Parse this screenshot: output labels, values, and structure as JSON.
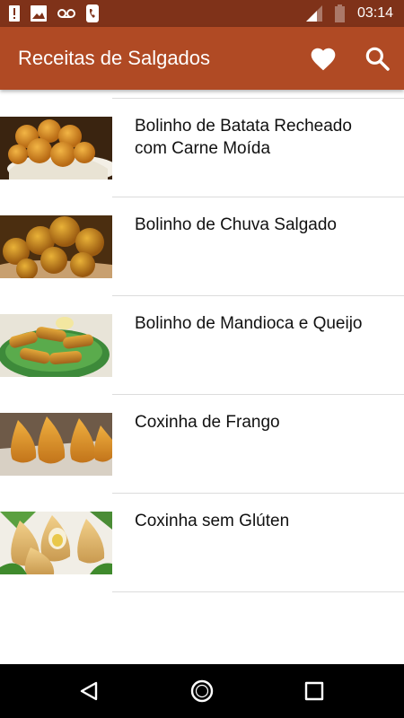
{
  "status_bar": {
    "time": "03:14",
    "icons": [
      "alert-icon",
      "image-icon",
      "voicemail-icon",
      "phone-icon",
      "signal-icon",
      "battery-icon"
    ]
  },
  "app_bar": {
    "title": "Receitas de Salgados",
    "actions": [
      "favorites-heart-icon",
      "search-icon"
    ]
  },
  "recipes": [
    {
      "title": "Bolinho de Batata Recheado com Carne Moída"
    },
    {
      "title": "Bolinho de Chuva Salgado"
    },
    {
      "title": "Bolinho de Mandioca e Queijo"
    },
    {
      "title": "Coxinha de Frango"
    },
    {
      "title": "Coxinha sem Glúten"
    }
  ],
  "nav_bar": {
    "buttons": [
      "back-icon",
      "home-icon",
      "recents-icon"
    ]
  },
  "colors": {
    "status_bar": "#7f3219",
    "app_bar": "#b04a24",
    "nav_bar": "#000000"
  }
}
